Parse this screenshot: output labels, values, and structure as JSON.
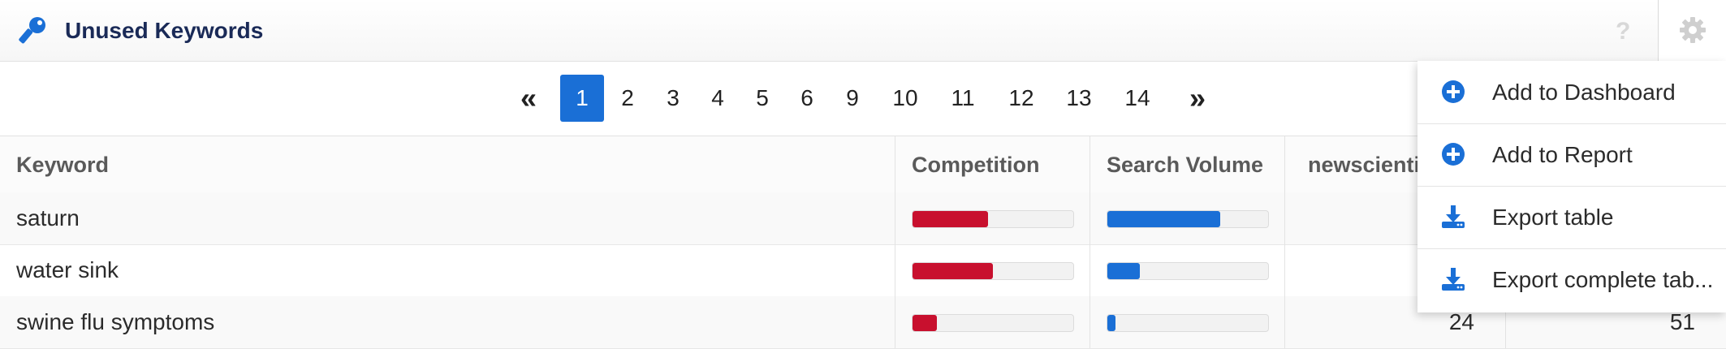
{
  "header": {
    "title": "Unused Keywords",
    "help": "?",
    "icons": {
      "title": "key-icon",
      "help": "question-icon",
      "settings": "gear-icon"
    }
  },
  "pagination": {
    "first": "«",
    "last": "»",
    "pages": [
      "1",
      "2",
      "3",
      "4",
      "5",
      "6",
      "9",
      "10",
      "11",
      "12",
      "13",
      "14"
    ],
    "active_page": "1"
  },
  "table": {
    "columns": [
      "Keyword",
      "Competition",
      "Search Volume",
      "newscientis"
    ],
    "rows": [
      {
        "keyword": "saturn",
        "competition": 0.47,
        "search_volume": 0.7,
        "site": "",
        "extra": ""
      },
      {
        "keyword": "water sink",
        "competition": 0.5,
        "search_volume": 0.2,
        "site": "",
        "extra": ""
      },
      {
        "keyword": "swine flu symptoms",
        "competition": 0.15,
        "search_volume": 0.05,
        "site": "24",
        "extra": "51"
      }
    ]
  },
  "menu": {
    "items": [
      {
        "label": "Add to Dashboard",
        "icon": "plus-circle-icon"
      },
      {
        "label": "Add to Report",
        "icon": "plus-circle-icon"
      },
      {
        "label": "Export table",
        "icon": "download-icon"
      },
      {
        "label": "Export complete tab...",
        "icon": "download-icon"
      }
    ]
  },
  "colors": {
    "accent": "#1a6fd6",
    "competition_bar": "#c8102e",
    "volume_bar": "#1a6fd6",
    "title": "#1a2a57"
  }
}
